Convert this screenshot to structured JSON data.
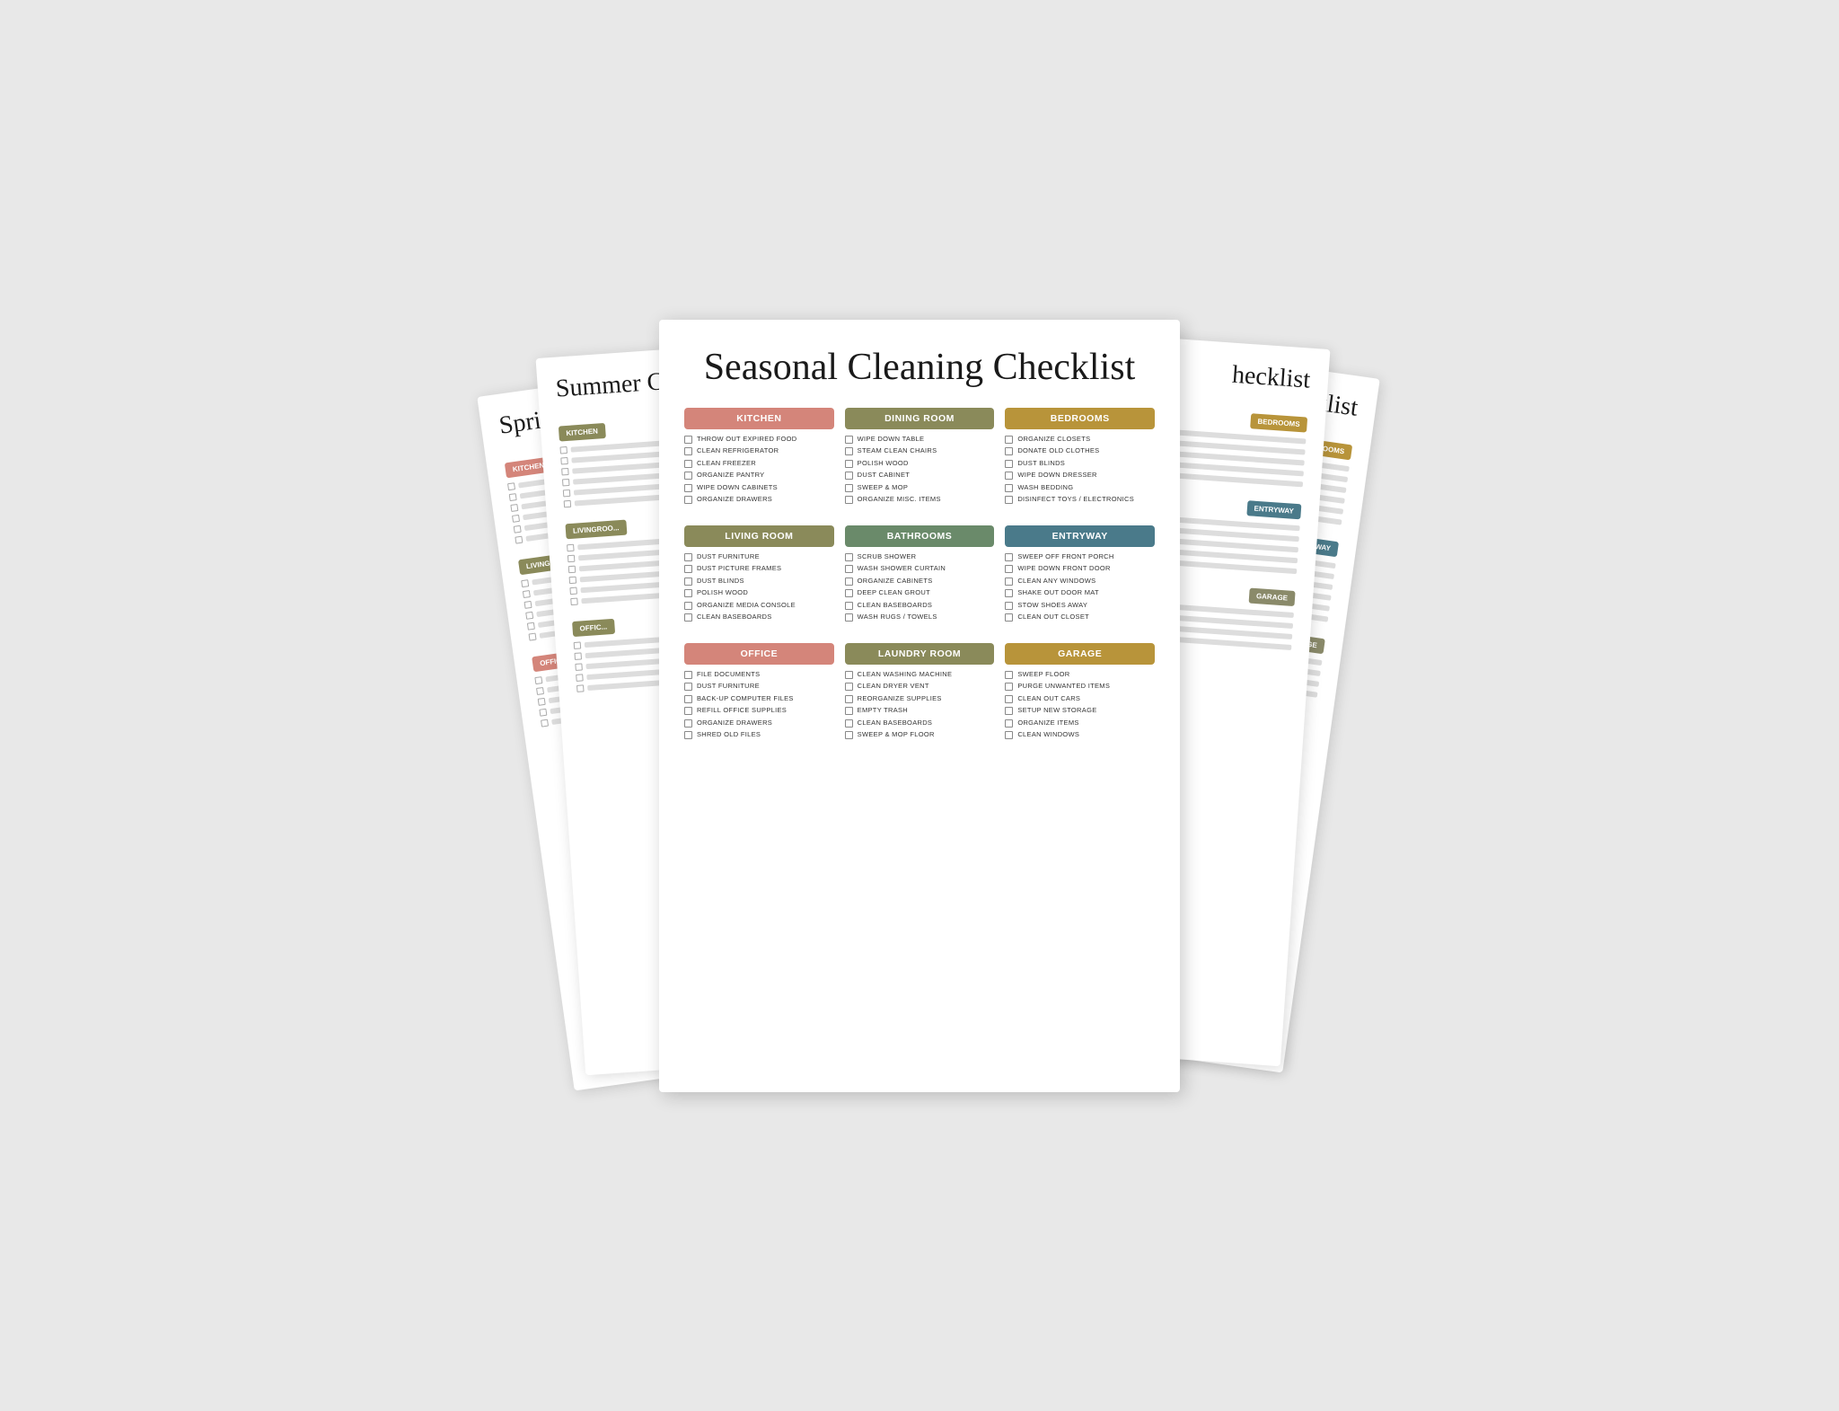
{
  "title": "Seasonal Cleaning Checklist",
  "back_left_title": "Spring",
  "back_mid_title": "Summer C",
  "sections": {
    "kitchen": {
      "label": "KITCHEN",
      "color": "pink",
      "items": [
        "THROW OUT EXPIRED FOOD",
        "CLEAN REFRIGERATOR",
        "CLEAN FREEZER",
        "ORGANIZE PANTRY",
        "WIPE DOWN CABINETS",
        "ORGANIZE DRAWERS"
      ]
    },
    "dining_room": {
      "label": "DINING ROOM",
      "color": "olive",
      "items": [
        "WIPE DOWN TABLE",
        "STEAM CLEAN CHAIRS",
        "POLISH WOOD",
        "DUST CABINET",
        "SWEEP & MOP",
        "ORGANIZE MISC. ITEMS"
      ]
    },
    "bedrooms": {
      "label": "BEDROOMS",
      "color": "gold",
      "items": [
        "ORGANIZE CLOSETS",
        "DONATE OLD CLOTHES",
        "DUST BLINDS",
        "WIPE DOWN DRESSER",
        "WASH BEDDING",
        "DISINFECT TOYS / ELECTRONICS"
      ]
    },
    "living_room": {
      "label": "LIVING ROOM",
      "color": "olive",
      "items": [
        "DUST FURNITURE",
        "DUST PICTURE FRAMES",
        "DUST BLINDS",
        "POLISH WOOD",
        "ORGANIZE MEDIA CONSOLE",
        "CLEAN BASEBOARDS"
      ]
    },
    "bathrooms": {
      "label": "BATHROOMS",
      "color": "sage",
      "items": [
        "SCRUB SHOWER",
        "WASH SHOWER CURTAIN",
        "ORGANIZE CABINETS",
        "DEEP CLEAN GROUT",
        "CLEAN BASEBOARDS",
        "WASH RUGS / TOWELS"
      ]
    },
    "entryway": {
      "label": "ENTRYWAY",
      "color": "blue-teal",
      "items": [
        "SWEEP OFF FRONT PORCH",
        "WIPE DOWN FRONT DOOR",
        "CLEAN ANY WINDOWS",
        "SHAKE OUT DOOR MAT",
        "STOW SHOES AWAY",
        "CLEAN OUT CLOSET"
      ]
    },
    "office": {
      "label": "OFFICE",
      "color": "pink",
      "items": [
        "FILE DOCUMENTS",
        "DUST FURNITURE",
        "BACK-UP COMPUTER FILES",
        "REFILL OFFICE SUPPLIES",
        "ORGANIZE DRAWERS",
        "SHRED OLD FILES"
      ]
    },
    "laundry_room": {
      "label": "LAUNDRY ROOM",
      "color": "olive",
      "items": [
        "CLEAN WASHING MACHINE",
        "CLEAN DRYER VENT",
        "REORGANIZE SUPPLIES",
        "EMPTY TRASH",
        "CLEAN BASEBOARDS",
        "SWEEP & MOP FLOOR"
      ]
    },
    "garage": {
      "label": "GARAGE",
      "color": "gold",
      "items": [
        "SWEEP FLOOR",
        "PURGE UNWANTED ITEMS",
        "CLEAN OUT CARS",
        "SETUP NEW STORAGE",
        "ORGANIZE ITEMS",
        "CLEAN WINDOWS"
      ]
    }
  },
  "back_sections": {
    "left": {
      "title": "Spring",
      "sections": [
        "KITCHEN",
        "LIVINGROOM",
        "OFFICE"
      ]
    },
    "mid": {
      "title": "Summer C",
      "sections": [
        "KITCHEN",
        "LIVINGROOM",
        "OFFICE"
      ]
    },
    "right_far": {
      "sections": [
        "BEDROOMS",
        "ENTRYWAY",
        "GARAGE"
      ]
    },
    "right_mid": {
      "sections": [
        "BEDROOMS",
        "ENTRYWAY",
        "GARAGE"
      ]
    }
  }
}
